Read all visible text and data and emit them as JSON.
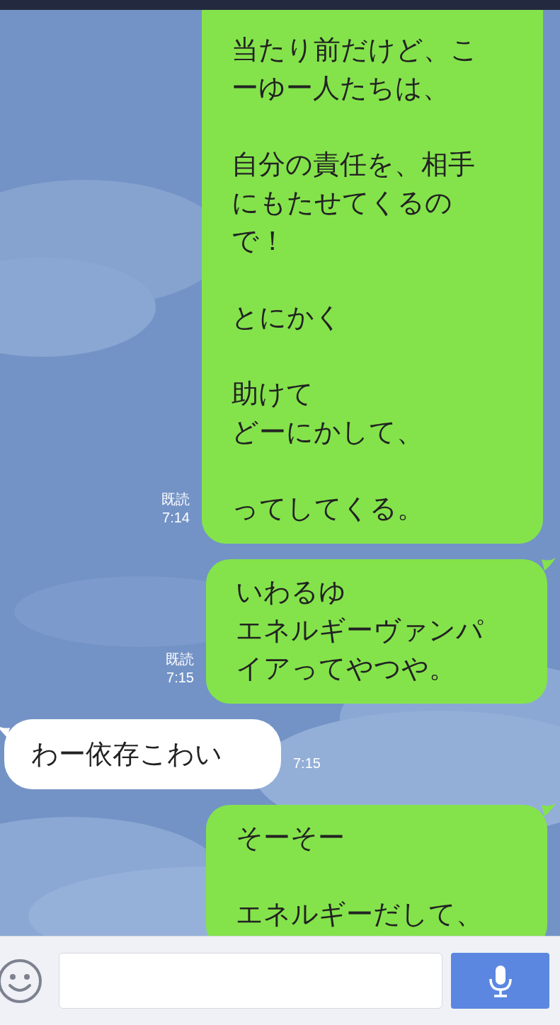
{
  "messages": [
    {
      "kind": "sent",
      "paragraphs": [
        [
          "当たり前だけど、こ",
          "ーゆー人たちは、"
        ],
        [
          "自分の責任を、相手",
          "にもたせてくるの",
          "で！"
        ],
        [
          "とにかく"
        ],
        [
          "助けて",
          "どーにかして、"
        ],
        [
          "ってしてくる。"
        ]
      ],
      "read_label": "既読",
      "time": "7:14"
    },
    {
      "kind": "sent",
      "paragraphs": [
        [
          "いわるゆ",
          "エネルギーヴァンパ",
          "イアってやつや。"
        ]
      ],
      "read_label": "既読",
      "time": "7:15"
    },
    {
      "kind": "received",
      "paragraphs": [
        [
          "わー依存こわい"
        ]
      ],
      "time": "7:15"
    },
    {
      "kind": "sent",
      "paragraphs": [
        [
          "そーそー"
        ],
        [
          "エネルギーだして、"
        ]
      ]
    }
  ]
}
